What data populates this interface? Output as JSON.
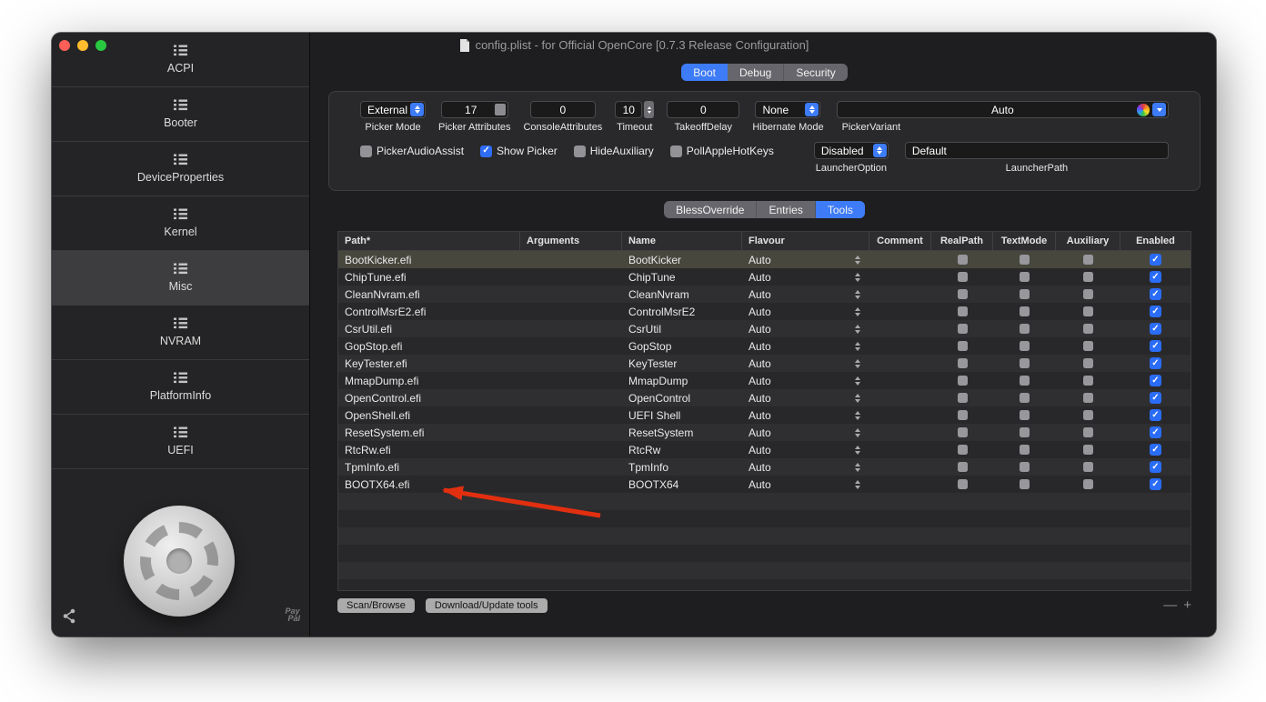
{
  "window": {
    "title": "config.plist - for Official OpenCore [0.7.3 Release Configuration]"
  },
  "sidebar": {
    "items": [
      {
        "label": "ACPI",
        "selected": false
      },
      {
        "label": "Booter",
        "selected": false
      },
      {
        "label": "DeviceProperties",
        "selected": false
      },
      {
        "label": "Kernel",
        "selected": false
      },
      {
        "label": "Misc",
        "selected": true
      },
      {
        "label": "NVRAM",
        "selected": false
      },
      {
        "label": "PlatformInfo",
        "selected": false
      },
      {
        "label": "UEFI",
        "selected": false
      }
    ],
    "paypal_line1": "Pay",
    "paypal_line2": "Pal"
  },
  "top_tabs": {
    "items": [
      "Boot",
      "Debug",
      "Security"
    ],
    "selected": "Boot"
  },
  "boot_form": {
    "picker_mode": {
      "value": "External",
      "label": "Picker Mode"
    },
    "picker_attributes": {
      "value": "17",
      "label": "Picker Attributes"
    },
    "console_attributes": {
      "value": "0",
      "label": "ConsoleAttributes"
    },
    "timeout": {
      "value": "10",
      "label": "Timeout"
    },
    "takeoff_delay": {
      "value": "0",
      "label": "TakeoffDelay"
    },
    "hibernate_mode": {
      "value": "None",
      "label": "Hibernate Mode"
    },
    "picker_variant": {
      "value": "Auto",
      "label": "PickerVariant"
    },
    "checkboxes": [
      {
        "label": "PickerAudioAssist",
        "checked": false
      },
      {
        "label": "Show Picker",
        "checked": true
      },
      {
        "label": "HideAuxiliary",
        "checked": false
      },
      {
        "label": "PollAppleHotKeys",
        "checked": false
      }
    ],
    "launcher_option": {
      "value": "Disabled",
      "label": "LauncherOption"
    },
    "launcher_path": {
      "value": "Default",
      "label": "LauncherPath"
    }
  },
  "table_tabs": {
    "items": [
      "BlessOverride",
      "Entries",
      "Tools"
    ],
    "selected": "Tools"
  },
  "tools_table": {
    "columns": [
      "Path*",
      "Arguments",
      "Name",
      "Flavour",
      "Comment",
      "RealPath",
      "TextMode",
      "Auxiliary",
      "Enabled"
    ],
    "rows": [
      {
        "path": "BootKicker.efi",
        "arguments": "",
        "name": "BootKicker",
        "flavour": "Auto",
        "enabled": true,
        "selected": true
      },
      {
        "path": "ChipTune.efi",
        "arguments": "",
        "name": "ChipTune",
        "flavour": "Auto",
        "enabled": true
      },
      {
        "path": "CleanNvram.efi",
        "arguments": "",
        "name": "CleanNvram",
        "flavour": "Auto",
        "enabled": true
      },
      {
        "path": "ControlMsrE2.efi",
        "arguments": "",
        "name": "ControlMsrE2",
        "flavour": "Auto",
        "enabled": true
      },
      {
        "path": "CsrUtil.efi",
        "arguments": "",
        "name": "CsrUtil",
        "flavour": "Auto",
        "enabled": true
      },
      {
        "path": "GopStop.efi",
        "arguments": "",
        "name": "GopStop",
        "flavour": "Auto",
        "enabled": true
      },
      {
        "path": "KeyTester.efi",
        "arguments": "",
        "name": "KeyTester",
        "flavour": "Auto",
        "enabled": true
      },
      {
        "path": "MmapDump.efi",
        "arguments": "",
        "name": "MmapDump",
        "flavour": "Auto",
        "enabled": true
      },
      {
        "path": "OpenControl.efi",
        "arguments": "",
        "name": "OpenControl",
        "flavour": "Auto",
        "enabled": true
      },
      {
        "path": "OpenShell.efi",
        "arguments": "",
        "name": "UEFI Shell",
        "flavour": "Auto",
        "enabled": true
      },
      {
        "path": "ResetSystem.efi",
        "arguments": "",
        "name": "ResetSystem",
        "flavour": "Auto",
        "enabled": true
      },
      {
        "path": "RtcRw.efi",
        "arguments": "",
        "name": "RtcRw",
        "flavour": "Auto",
        "enabled": true
      },
      {
        "path": "TpmInfo.efi",
        "arguments": "",
        "name": "TpmInfo",
        "flavour": "Auto",
        "enabled": true
      },
      {
        "path": "BOOTX64.efi",
        "arguments": "",
        "name": "BOOTX64",
        "flavour": "Auto",
        "enabled": true
      }
    ],
    "empty_row_count": 6
  },
  "footer": {
    "scan_browse": "Scan/Browse",
    "download_update": "Download/Update tools",
    "remove_label": "—",
    "add_label": "+"
  }
}
